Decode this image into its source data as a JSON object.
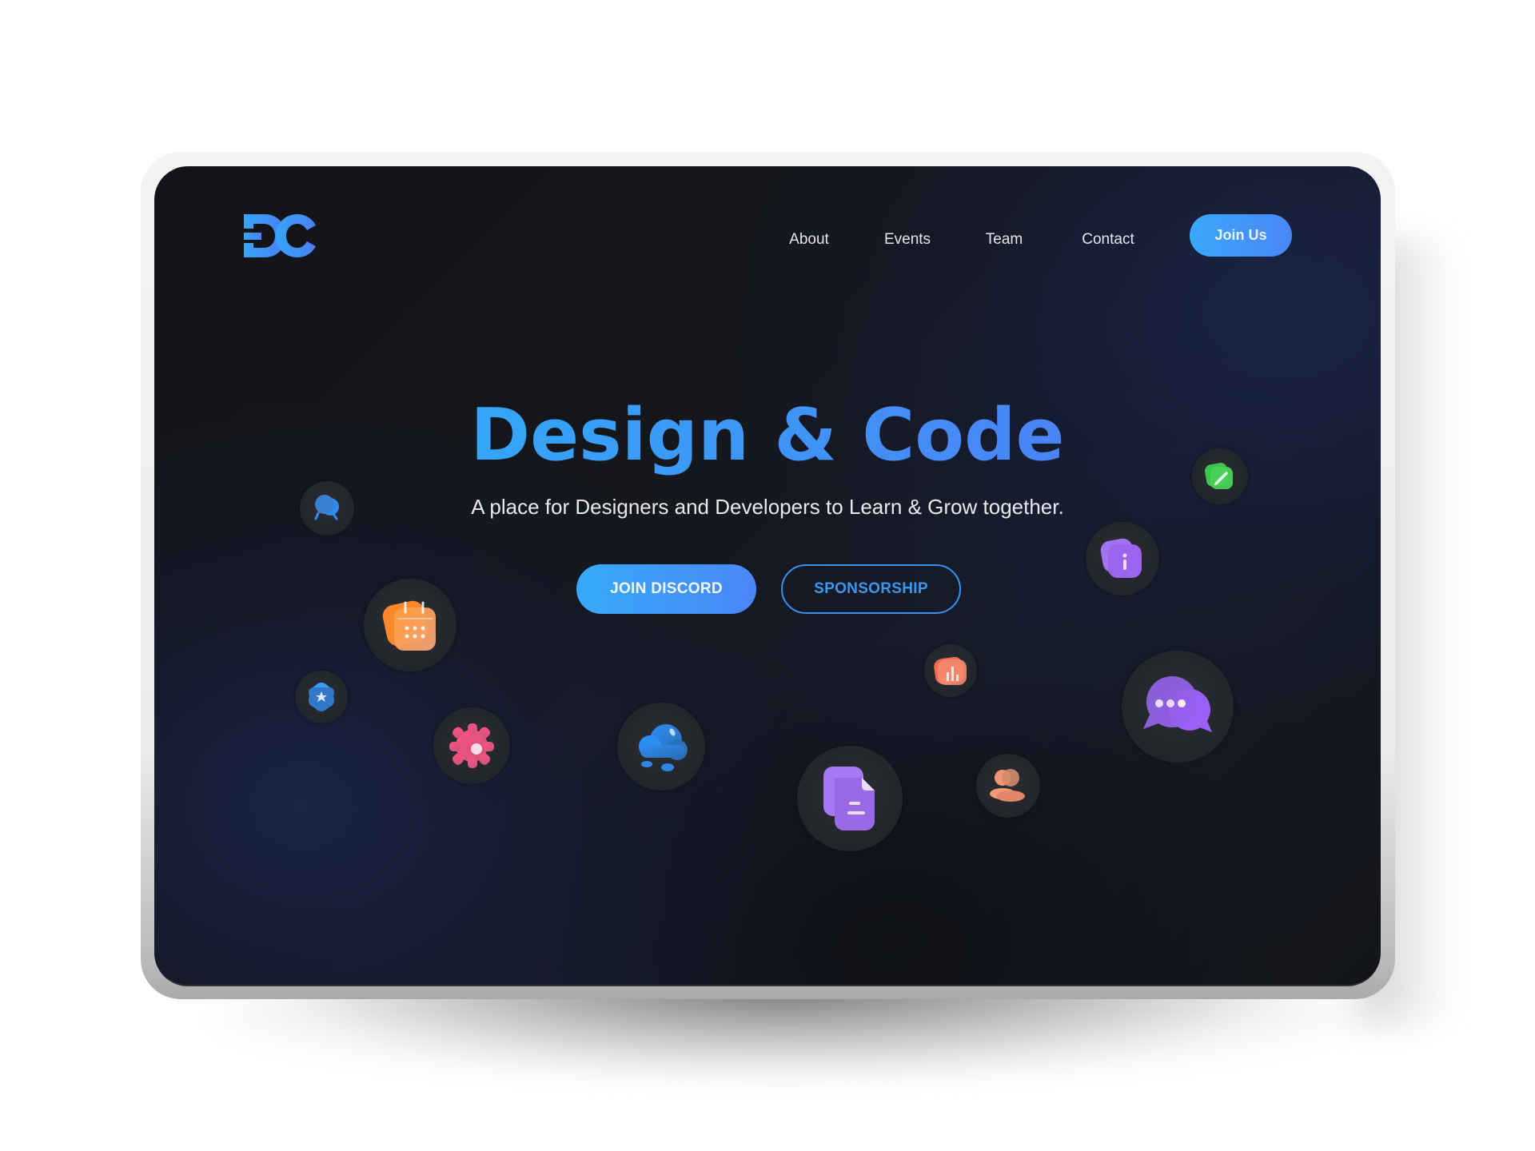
{
  "brand": {
    "logo_text": "DC",
    "accent": "#35a4f7",
    "accent_end": "#4a84f5"
  },
  "nav": {
    "links": [
      {
        "label": "About"
      },
      {
        "label": "Events"
      },
      {
        "label": "Team"
      },
      {
        "label": "Contact"
      }
    ],
    "cta_label": "Join Us"
  },
  "hero": {
    "title": "Design & Code",
    "subtitle": "A place for Designers and Developers to Learn & Grow together.",
    "primary_button": "JOIN DISCORD",
    "secondary_button": "SPONSORSHIP"
  },
  "floating_icons": [
    {
      "name": "chat-icon",
      "color": "#3b8fe6"
    },
    {
      "name": "calendar-icon",
      "color": "#f08a3c"
    },
    {
      "name": "star-badge-icon",
      "color": "#3a86e0"
    },
    {
      "name": "gear-icon",
      "color": "#f0557f"
    },
    {
      "name": "cloud-icon",
      "color": "#2f8cf0"
    },
    {
      "name": "document-icon",
      "color": "#9b6cf0"
    },
    {
      "name": "bar-chart-icon",
      "color": "#f07658"
    },
    {
      "name": "user-icon",
      "color": "#ee8a6c"
    },
    {
      "name": "message-icon",
      "color": "#9463ee"
    },
    {
      "name": "info-icon",
      "color": "#9a66ee"
    },
    {
      "name": "pencil-icon",
      "color": "#43c451"
    }
  ]
}
